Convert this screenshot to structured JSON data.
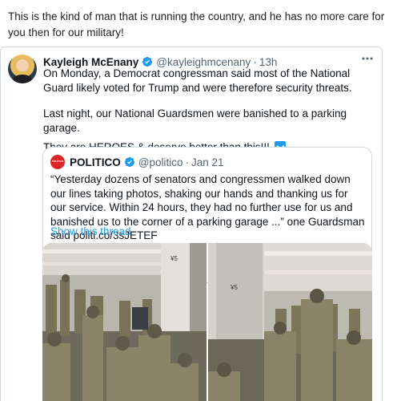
{
  "post": {
    "caption": "This is the kind of man that is running the country, and he has no more care for you then for our military!"
  },
  "tweet": {
    "author_name": "Kayleigh McEnany",
    "handle": "@kayleighmcenany",
    "separator": "·",
    "timestamp": "13h",
    "paragraphs": [
      "On Monday, a Democrat congressman said most of the National Guard likely voted for Trump and were therefore security threats.",
      "Last night, our National Guardsmen were banished to a parking garage.",
      "They are HEROES & deserve better than this!!!"
    ],
    "icons": {
      "verified": "verified-badge-icon",
      "more": "more-options-icon",
      "emoji": "down-arrow-emoji-icon"
    }
  },
  "quoted": {
    "author_name": "POLITICO",
    "handle": "@politico",
    "separator": "·",
    "timestamp": "Jan 21",
    "text": "“Yesterday dozens of senators and congressmen walked down our lines taking photos, shaking our hands and thanking us for our service. Within 24 hours, they had no further use for us and banished us to the corner of a parking garage ...” one Guardsman said politi.co/3sJETEF",
    "show_thread": "Show this thread"
  },
  "media": {
    "photos": [
      {
        "pillar_label": "¥5"
      },
      {
        "pillar_label": "¥5"
      }
    ]
  },
  "colors": {
    "accent": "#1d9bf0",
    "verified": "#1d9bf0",
    "politico_red": "#dc2626",
    "border": "#cfd9de"
  }
}
